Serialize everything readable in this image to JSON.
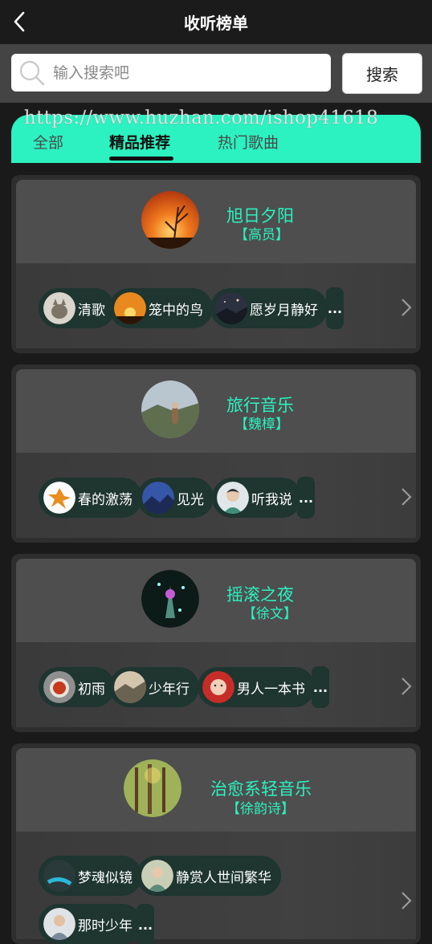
{
  "header": {
    "title": "收听榜单"
  },
  "search": {
    "placeholder": "输入搜索吧",
    "value": "",
    "button_label": "搜索"
  },
  "watermark": "https://www.huzhan.com/ishop41618",
  "tabs": [
    {
      "label": "全部",
      "active": false
    },
    {
      "label": "精品推荐",
      "active": true
    },
    {
      "label": "热门歌曲",
      "active": false
    }
  ],
  "colors": {
    "accent": "#2bf2c0",
    "chip_bg": "#1e3530",
    "card_bg": "#2e2e2e"
  },
  "playlists": [
    {
      "name": "旭日夕阳",
      "author": "【高员】",
      "cover_icon": "sunset-grass-cover",
      "songs": [
        {
          "title": "清歌",
          "thumb": "cat-thumb"
        },
        {
          "title": "笼中的鸟",
          "thumb": "sunset-thumb"
        },
        {
          "title": "愿岁月静好",
          "thumb": "night-sky-thumb"
        }
      ],
      "more": "..."
    },
    {
      "name": "旅行音乐",
      "author": "【魏樟】",
      "cover_icon": "hikers-cover",
      "songs": [
        {
          "title": "春的激荡",
          "thumb": "dancer-thumb"
        },
        {
          "title": "见光",
          "thumb": "mountain-thumb"
        },
        {
          "title": "听我说",
          "thumb": "portrait-thumb"
        }
      ],
      "more": "..."
    },
    {
      "name": "摇滚之夜",
      "author": "【徐文】",
      "cover_icon": "concert-cover",
      "songs": [
        {
          "title": "初雨",
          "thumb": "food-thumb"
        },
        {
          "title": "少年行",
          "thumb": "landscape-thumb"
        },
        {
          "title": "男人一本书",
          "thumb": "baby-thumb"
        }
      ],
      "more": "..."
    },
    {
      "name": "治愈系轻音乐",
      "author": "【徐韵诗】",
      "cover_icon": "forest-cover",
      "songs": [
        {
          "title": "梦魂似镜",
          "thumb": "waterfall-thumb"
        },
        {
          "title": "静赏人世间繁华",
          "thumb": "girl-thumb"
        },
        {
          "title": "那时少年",
          "thumb": "boy-thumb"
        }
      ],
      "more": "..."
    }
  ]
}
